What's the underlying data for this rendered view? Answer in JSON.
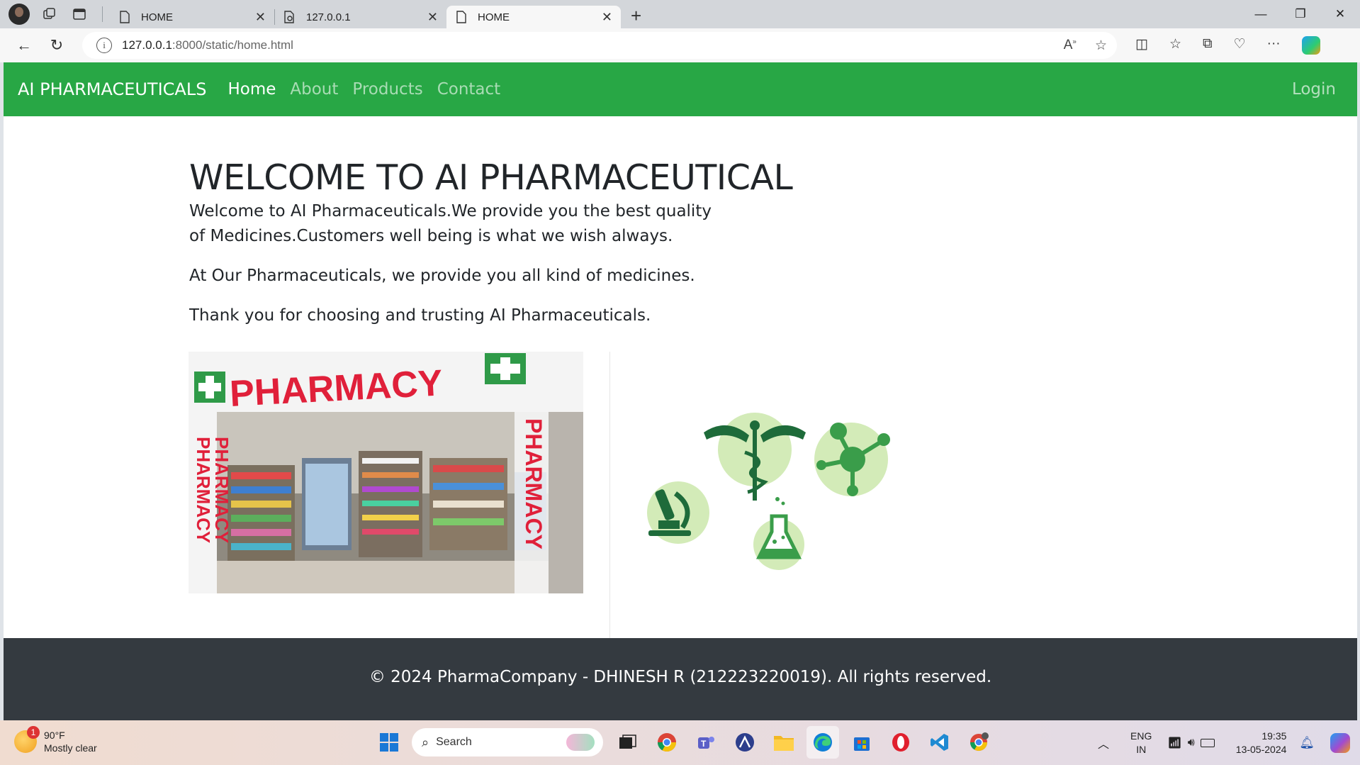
{
  "browser": {
    "tabs": [
      {
        "title": "HOME"
      },
      {
        "title": "127.0.0.1"
      },
      {
        "title": "HOME"
      }
    ],
    "url_host": "127.0.0.1",
    "url_rest": ":8000/static/home.html"
  },
  "site": {
    "brand": "AI PHARMACEUTICALS",
    "nav": [
      "Home",
      "About",
      "Products",
      "Contact"
    ],
    "login": "Login",
    "heading": "WELCOME TO AI PHARMACEUTICAL",
    "para1": "Welcome to AI Pharmaceuticals.We provide you the best quality of Medicines.Customers well being is what we wish always.",
    "para2": "At Our Pharmaceuticals, we provide you all kind of medicines.",
    "para3": "Thank you for choosing and trusting AI Pharmaceuticals.",
    "footer": "© 2024 PharmaCompany - DHINESH R (212223220019). All rights reserved.",
    "image_sign": "PHARMACY",
    "image_side_text": "PHARMACY"
  },
  "colors": {
    "nav_green": "#28a745",
    "footer_dark": "#343a40"
  },
  "taskbar": {
    "weather_temp": "90°F",
    "weather_desc": "Mostly clear",
    "weather_badge": "1",
    "search_placeholder": "Search",
    "lang_top": "ENG",
    "lang_bottom": "IN",
    "time": "19:35",
    "date": "13-05-2024"
  }
}
